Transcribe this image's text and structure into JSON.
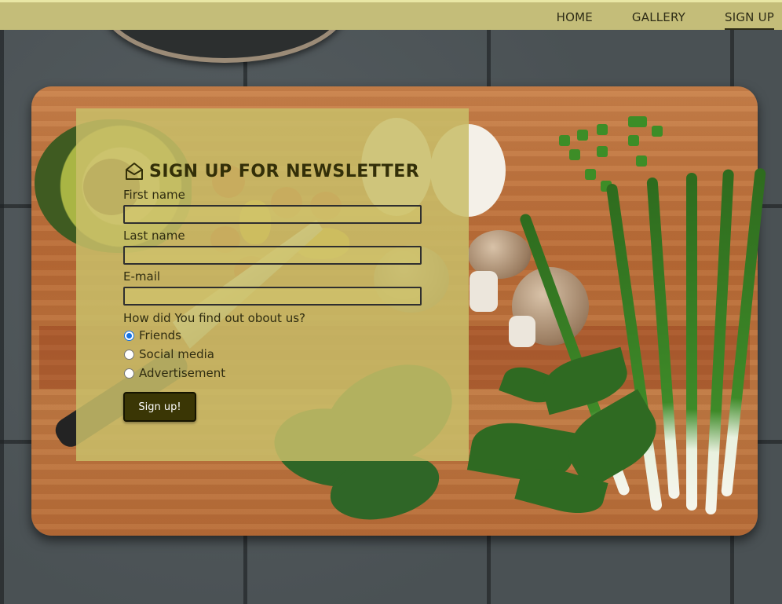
{
  "nav": {
    "items": [
      {
        "label": "HOME",
        "active": false
      },
      {
        "label": "GALLERY",
        "active": false
      },
      {
        "label": "SIGN UP",
        "active": true
      }
    ]
  },
  "newsletter": {
    "icon": "envelope-open-icon",
    "title": "SIGN UP FOR NEWSLETTER",
    "fields": [
      {
        "label": "First name",
        "value": ""
      },
      {
        "label": "Last name",
        "value": ""
      },
      {
        "label": "E-mail",
        "value": ""
      }
    ],
    "question": "How did You find out obout us?",
    "options": [
      {
        "label": "Friends",
        "checked": true
      },
      {
        "label": "Social media",
        "checked": false
      },
      {
        "label": "Advertisement",
        "checked": false
      }
    ],
    "submit_label": "Sign up!"
  },
  "colors": {
    "nav_bar": "#c4bd79",
    "panel": "#c8be69",
    "button": "#3a3605",
    "text": "#332f08"
  }
}
